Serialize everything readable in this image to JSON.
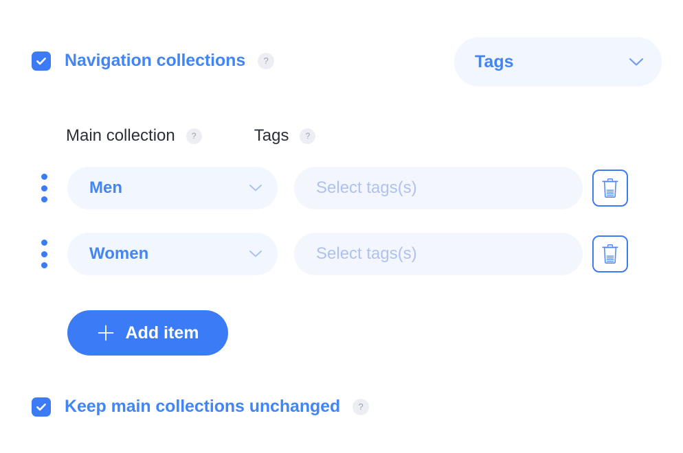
{
  "navigation_collections": {
    "label": "Navigation collections",
    "checked": true,
    "help": "?",
    "checkbox_color": "#3b7bf6",
    "label_color": "#4285f4"
  },
  "scope_dropdown": {
    "value": "Tags",
    "chevron": "chevron-down-icon",
    "background": "#f2f6fe"
  },
  "columns": {
    "main_collection": {
      "label": "Main collection",
      "help": "?"
    },
    "tags": {
      "label": "Tags",
      "help": "?"
    }
  },
  "items": [
    {
      "drag_handle": "drag-handle-icon",
      "collection": "Men",
      "tags_placeholder": "Select tags(s)",
      "tags_value": "",
      "delete_icon": "trash-icon"
    },
    {
      "drag_handle": "drag-handle-icon",
      "collection": "Women",
      "tags_placeholder": "Select tags(s)",
      "tags_value": "",
      "delete_icon": "trash-icon"
    }
  ],
  "add_item": {
    "label": "Add item",
    "icon": "plus-icon",
    "background": "#3b7bf6",
    "text_color": "#ffffff"
  },
  "keep_unchanged": {
    "label": "Keep main collections unchanged",
    "checked": true,
    "help": "?",
    "checkbox_color": "#3b7bf6",
    "label_color": "#4285f4"
  },
  "theme": {
    "page_background": "#ffffff",
    "accent_blue": "#3b7bf6",
    "pill_background": "#f2f6fe",
    "placeholder_blue": "#aec2f0",
    "help_badge_background": "#eceef3",
    "help_badge_text": "#9aa0ae",
    "header_text": "#2b2f36"
  }
}
